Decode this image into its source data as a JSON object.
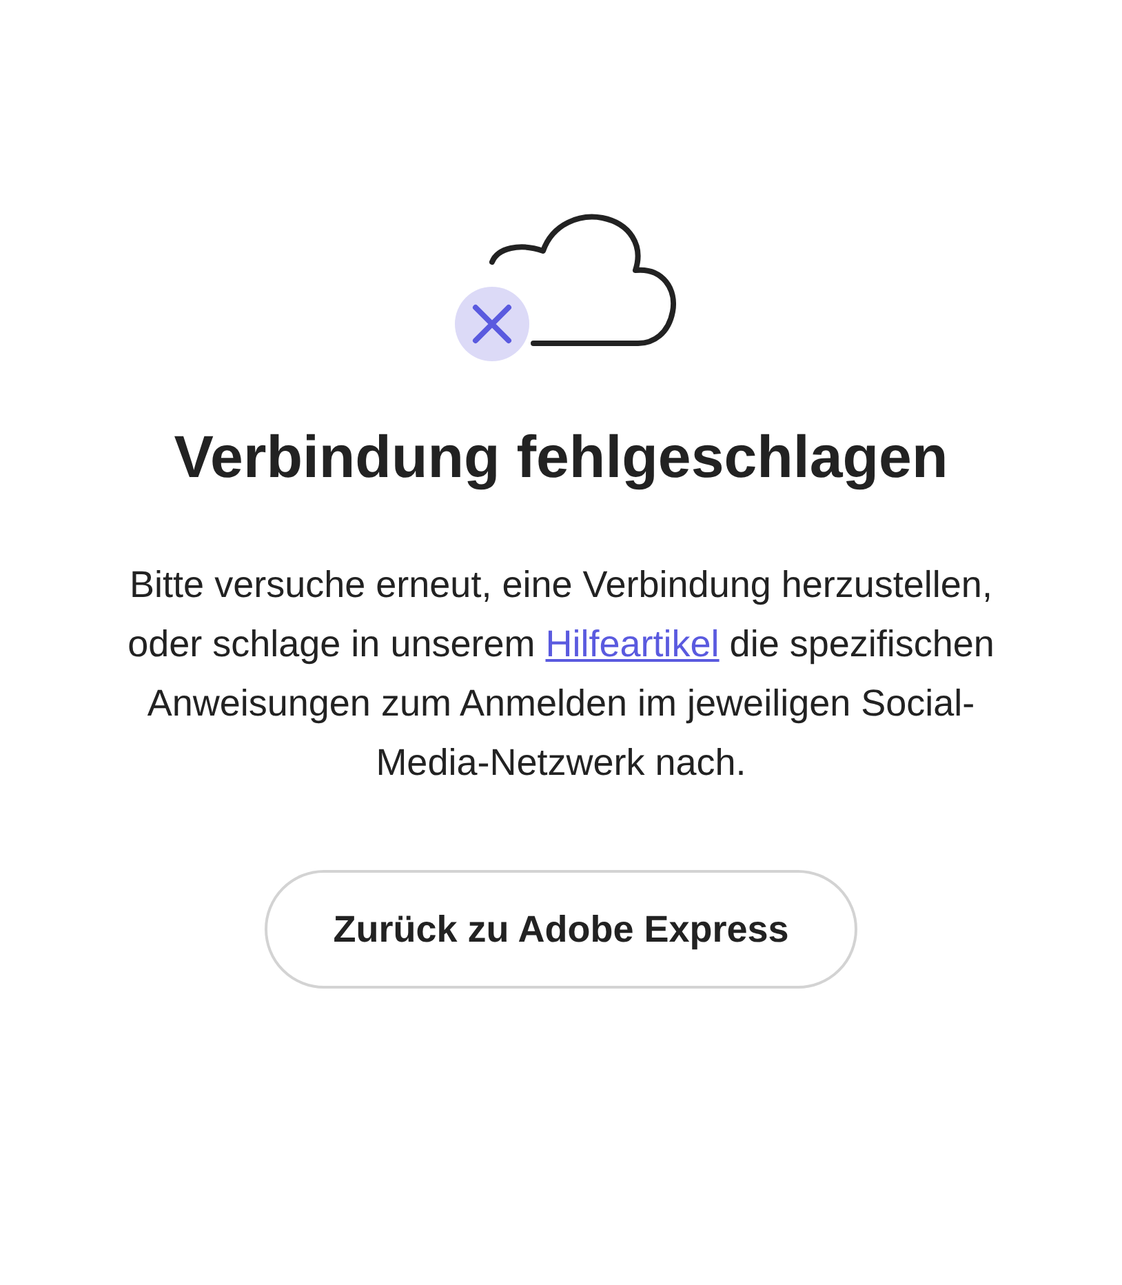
{
  "heading": "Verbindung fehlgeschlagen",
  "message": {
    "before": "Bitte versuche erneut, eine Verbindung herzustellen, oder schlage in unserem",
    "link": "Hilfeartikel",
    "after": "die spezifischen Anweisungen zum Anmelden im jeweiligen Social-Media-Netzwerk nach."
  },
  "button": "Zurück zu Adobe Express"
}
